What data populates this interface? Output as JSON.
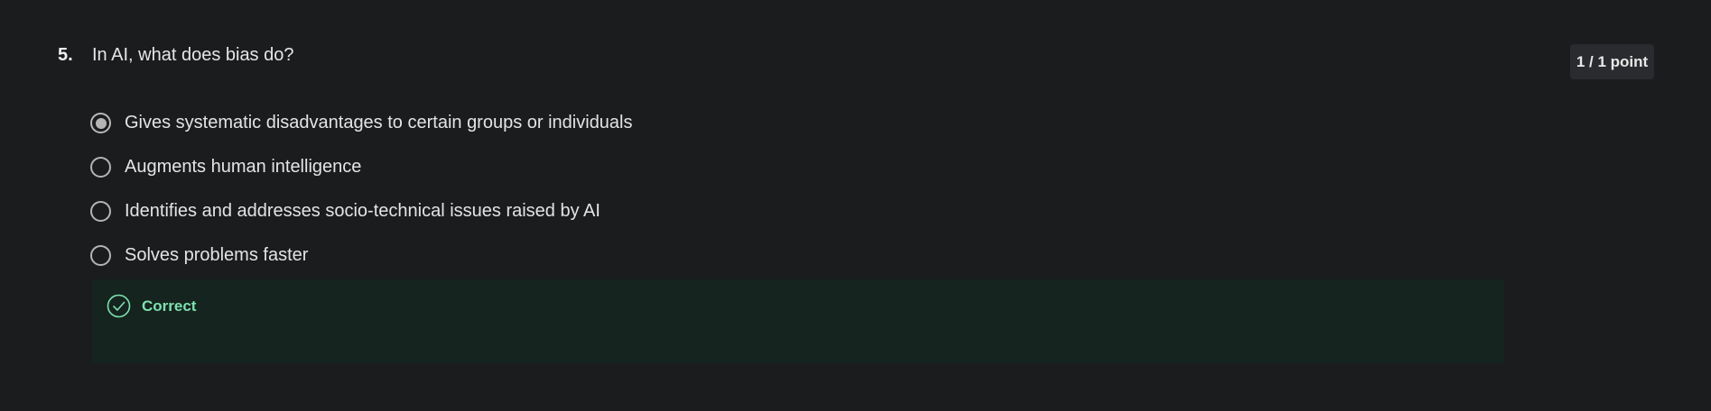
{
  "question": {
    "number": "5.",
    "text": "In AI, what does bias do?",
    "points": "1 / 1 point"
  },
  "options": [
    {
      "label": "Gives systematic disadvantages to certain groups or individuals",
      "selected": true
    },
    {
      "label": "Augments human intelligence",
      "selected": false
    },
    {
      "label": "Identifies and addresses socio-technical issues raised by AI",
      "selected": false
    },
    {
      "label": "Solves problems faster",
      "selected": false
    }
  ],
  "feedback": {
    "status": "Correct",
    "icon": "check-circle-icon",
    "color": "#7ee0b0",
    "background": "#15241f"
  },
  "colors": {
    "background": "#1b1c1e",
    "badge_background": "#2a2b2e",
    "radio": "#b4b4b4"
  }
}
